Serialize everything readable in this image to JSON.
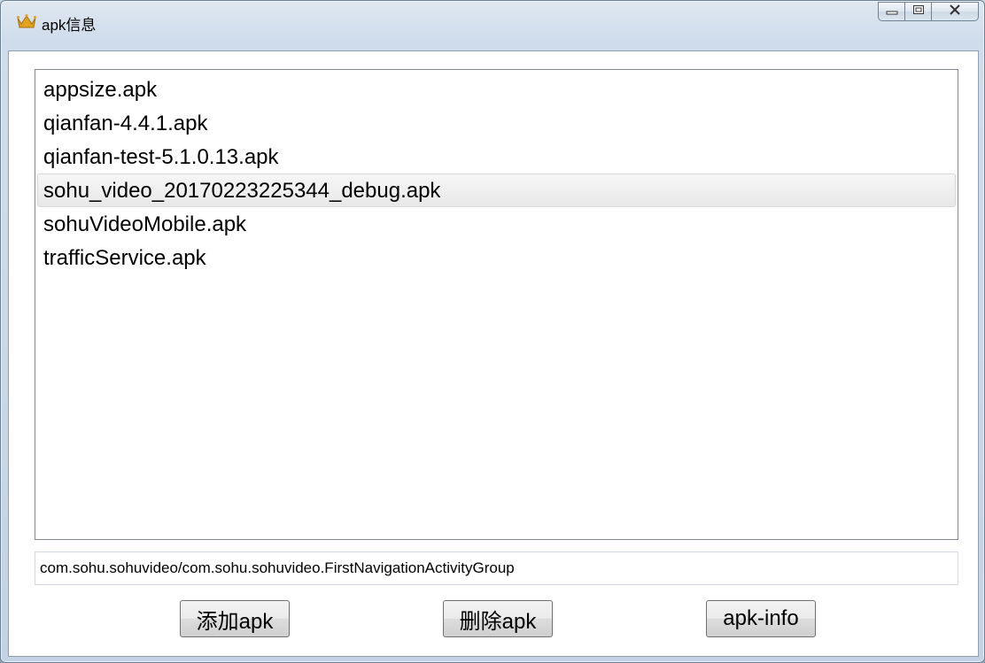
{
  "window": {
    "title": "apk信息"
  },
  "list": {
    "items": [
      "appsize.apk",
      "qianfan-4.4.1.apk",
      "qianfan-test-5.1.0.13.apk",
      "sohu_video_20170223225344_debug.apk",
      "sohuVideoMobile.apk",
      "trafficService.apk"
    ],
    "selected_index": 3
  },
  "info_field": {
    "value": "com.sohu.sohuvideo/com.sohu.sohuvideo.FirstNavigationActivityGroup"
  },
  "buttons": {
    "add": "添加apk",
    "delete": "删除apk",
    "info": "apk-info"
  },
  "icons": {
    "app": "crown-icon",
    "minimize": "minimize-icon",
    "maximize": "maximize-icon",
    "close": "close-icon"
  },
  "colors": {
    "crown": "#e2a21c",
    "selection": "#e8e8e8"
  }
}
